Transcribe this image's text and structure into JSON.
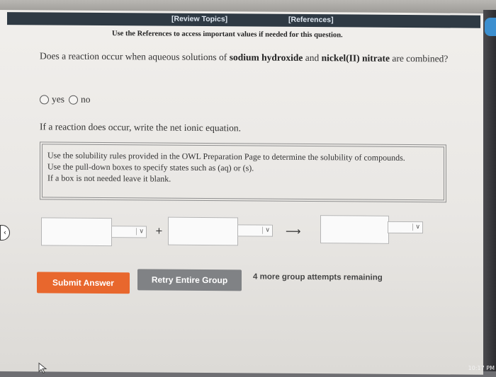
{
  "nav": {
    "review_topics": "[Review Topics]",
    "references": "[References]"
  },
  "reference_note": "Use the References to access important values if needed for this question.",
  "question": {
    "prefix": "Does a reaction occur when aqueous solutions of ",
    "reactant1": "sodium hydroxide",
    "middle": " and ",
    "reactant2": "nickel(II) nitrate",
    "suffix": " are combined?"
  },
  "options": [
    "yes",
    "no"
  ],
  "prompt": "If a reaction does occur, write the net ionic equation.",
  "info_lines": [
    "Use the solubility rules provided in the OWL Preparation Page to determine the solubility of compounds.",
    "Use the pull-down boxes to specify states such as (aq) or (s).",
    "If a box is not needed leave it blank."
  ],
  "equation": {
    "plus": "+",
    "arrow": "⟶"
  },
  "buttons": {
    "submit": "Submit Answer",
    "retry": "Retry Entire Group"
  },
  "attempts_text": "4 more group attempts remaining",
  "icons": {
    "cursor": "pointer-cursor-icon",
    "dropdown": "chevron-down-icon",
    "side_tab": "chevron-left-icon"
  },
  "colors": {
    "submit_button": "#e8672d",
    "retry_button": "#808285",
    "top_bar": "#2f3a44"
  },
  "status_clock": "10:17 PM"
}
